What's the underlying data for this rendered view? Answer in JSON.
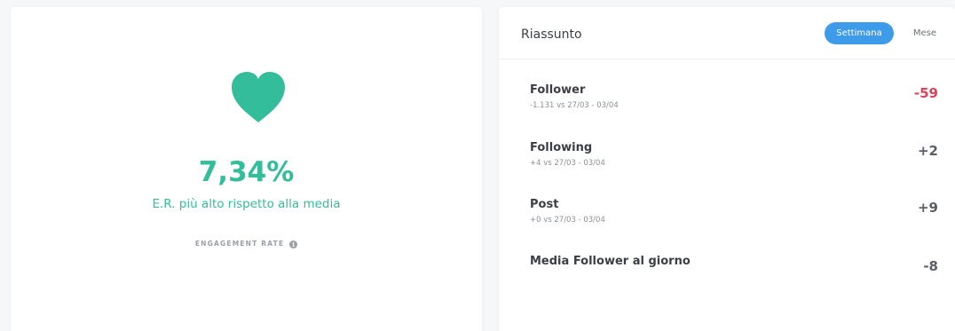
{
  "engagement": {
    "value": "7,34%",
    "description": "E.R. più alto rispetto alla media",
    "label": "ENGAGEMENT RATE",
    "info_icon": "info-icon"
  },
  "summary": {
    "title": "Riassunto",
    "tabs": [
      {
        "label": "Settimana",
        "active": true
      },
      {
        "label": "Mese",
        "active": false
      }
    ],
    "metrics": [
      {
        "name": "Follower",
        "sub": "-1.131 vs 27/03 - 03/04",
        "value": "-59"
      },
      {
        "name": "Following",
        "sub": "+4 vs 27/03 - 03/04",
        "value": "+2"
      },
      {
        "name": "Post",
        "sub": "+0 vs 27/03 - 03/04",
        "value": "+9"
      },
      {
        "name": "Media Follower al giorno",
        "sub": "",
        "value": "-8"
      }
    ]
  },
  "colors": {
    "accent_green": "#34bd9b",
    "accent_blue": "#3d9be9",
    "negative_red": "#e0405a"
  }
}
